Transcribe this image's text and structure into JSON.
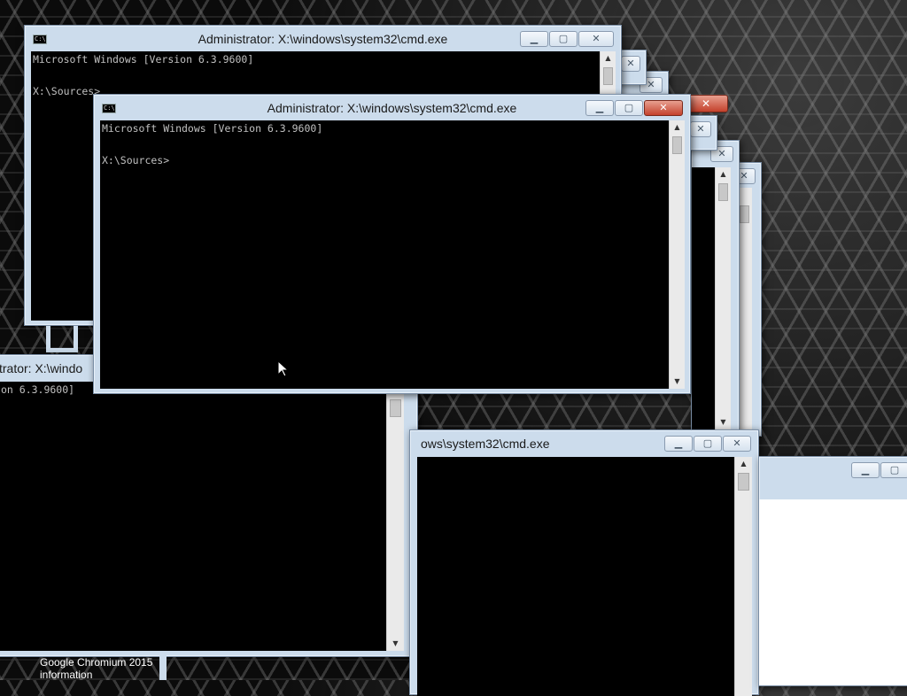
{
  "windows": {
    "main": {
      "title": "Administrator: X:\\windows\\system32\\cmd.exe",
      "line1": "Microsoft Windows [Version 6.3.9600]",
      "line2": "X:\\Sources>"
    },
    "back_top": {
      "title": "Administrator: X:\\windows\\system32\\cmd.exe",
      "line1": "Microsoft Windows [Version 6.3.9600]",
      "line2": "X:\\Sources>"
    },
    "left_lower": {
      "title_fragment": "trator: X:\\windo",
      "line1_fragment": "on 6.3.9600]"
    },
    "bottom_right": {
      "title_fragment": "ows\\system32\\cmd.exe"
    }
  },
  "buttons": {
    "minimize": "▁",
    "maximize": "▢",
    "close": "✕"
  },
  "icon_text": "C:\\",
  "taskbar_item": "Google Chromium 2015 information",
  "colors": {
    "console_bg": "#000000",
    "console_text": "#c0c0c0",
    "frame": "#ccdcec",
    "close_red": "#c4412c"
  }
}
